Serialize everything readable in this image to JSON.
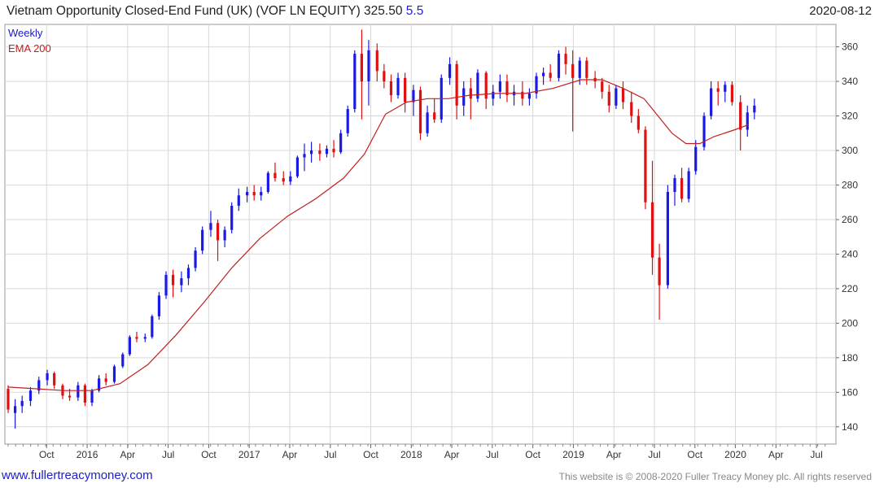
{
  "header": {
    "title": "Vietnam Opportunity Closed-End Fund (UK) (VOF LN EQUITY) 325.50",
    "change": "5.5",
    "date": "2020-08-12"
  },
  "footer": {
    "left": "www.fullertreacymoney.com",
    "right": "This website is © 2008-2020 Fuller Treacy Money plc. All rights reserved"
  },
  "chart_data": {
    "type": "candlestick",
    "legend": [
      {
        "label": "Weekly",
        "color": "#1a1ac8"
      },
      {
        "label": "EMA 200",
        "color": "#c02020"
      }
    ],
    "colors": {
      "up": "#1a1ae6",
      "down": "#e01010",
      "ema": "#c02020",
      "grid": "#d8d8d8"
    },
    "x_tick_labels": [
      "Oct",
      "2016",
      "Apr",
      "Jul",
      "Oct",
      "2017",
      "Apr",
      "Jul",
      "Oct",
      "2018",
      "Apr",
      "Jul",
      "Oct",
      "2019",
      "Apr",
      "Jul",
      "Oct",
      "2020",
      "Apr",
      "Jul"
    ],
    "y_ticks": [
      140,
      160,
      180,
      200,
      220,
      240,
      260,
      280,
      300,
      320,
      340,
      360
    ],
    "ylim": [
      130,
      373
    ],
    "x_range": [
      0,
      59
    ],
    "ohlc": [
      {
        "t": 0.0,
        "o": 162,
        "h": 164,
        "l": 148,
        "c": 150
      },
      {
        "t": 0.5,
        "o": 148,
        "h": 156,
        "l": 139,
        "c": 152
      },
      {
        "t": 1.0,
        "o": 152,
        "h": 158,
        "l": 148,
        "c": 155
      },
      {
        "t": 1.6,
        "o": 155,
        "h": 163,
        "l": 152,
        "c": 161
      },
      {
        "t": 2.2,
        "o": 161,
        "h": 169,
        "l": 159,
        "c": 167
      },
      {
        "t": 2.8,
        "o": 167,
        "h": 173,
        "l": 164,
        "c": 171
      },
      {
        "t": 3.3,
        "o": 171,
        "h": 172,
        "l": 162,
        "c": 164
      },
      {
        "t": 3.9,
        "o": 164,
        "h": 165,
        "l": 156,
        "c": 158
      },
      {
        "t": 4.4,
        "o": 158,
        "h": 162,
        "l": 155,
        "c": 157
      },
      {
        "t": 5.0,
        "o": 157,
        "h": 166,
        "l": 155,
        "c": 164
      },
      {
        "t": 5.5,
        "o": 164,
        "h": 165,
        "l": 152,
        "c": 154
      },
      {
        "t": 6.0,
        "o": 154,
        "h": 162,
        "l": 152,
        "c": 161
      },
      {
        "t": 6.5,
        "o": 161,
        "h": 170,
        "l": 160,
        "c": 168
      },
      {
        "t": 7.0,
        "o": 168,
        "h": 171,
        "l": 164,
        "c": 166
      },
      {
        "t": 7.6,
        "o": 166,
        "h": 176,
        "l": 165,
        "c": 175
      },
      {
        "t": 8.2,
        "o": 175,
        "h": 183,
        "l": 174,
        "c": 182
      },
      {
        "t": 8.7,
        "o": 182,
        "h": 193,
        "l": 181,
        "c": 192
      },
      {
        "t": 9.2,
        "o": 192,
        "h": 195,
        "l": 189,
        "c": 191
      },
      {
        "t": 9.8,
        "o": 191,
        "h": 194,
        "l": 189,
        "c": 192
      },
      {
        "t": 10.3,
        "o": 192,
        "h": 205,
        "l": 191,
        "c": 204
      },
      {
        "t": 10.8,
        "o": 204,
        "h": 218,
        "l": 202,
        "c": 216
      },
      {
        "t": 11.3,
        "o": 216,
        "h": 230,
        "l": 214,
        "c": 228
      },
      {
        "t": 11.8,
        "o": 228,
        "h": 231,
        "l": 215,
        "c": 222
      },
      {
        "t": 12.4,
        "o": 222,
        "h": 230,
        "l": 218,
        "c": 226
      },
      {
        "t": 12.9,
        "o": 226,
        "h": 234,
        "l": 222,
        "c": 232
      },
      {
        "t": 13.4,
        "o": 232,
        "h": 244,
        "l": 230,
        "c": 242
      },
      {
        "t": 13.9,
        "o": 242,
        "h": 256,
        "l": 240,
        "c": 254
      },
      {
        "t": 14.5,
        "o": 254,
        "h": 265,
        "l": 250,
        "c": 258
      },
      {
        "t": 15.0,
        "o": 258,
        "h": 260,
        "l": 236,
        "c": 248
      },
      {
        "t": 15.5,
        "o": 248,
        "h": 256,
        "l": 244,
        "c": 254
      },
      {
        "t": 16.0,
        "o": 254,
        "h": 270,
        "l": 252,
        "c": 268
      },
      {
        "t": 16.5,
        "o": 268,
        "h": 278,
        "l": 265,
        "c": 274
      },
      {
        "t": 17.1,
        "o": 274,
        "h": 279,
        "l": 270,
        "c": 276
      },
      {
        "t": 17.6,
        "o": 276,
        "h": 280,
        "l": 271,
        "c": 274
      },
      {
        "t": 18.1,
        "o": 274,
        "h": 279,
        "l": 271,
        "c": 276
      },
      {
        "t": 18.6,
        "o": 276,
        "h": 288,
        "l": 275,
        "c": 287
      },
      {
        "t": 19.1,
        "o": 287,
        "h": 293,
        "l": 282,
        "c": 284
      },
      {
        "t": 19.7,
        "o": 284,
        "h": 288,
        "l": 280,
        "c": 282
      },
      {
        "t": 20.2,
        "o": 282,
        "h": 288,
        "l": 280,
        "c": 285
      },
      {
        "t": 20.7,
        "o": 285,
        "h": 297,
        "l": 284,
        "c": 296
      },
      {
        "t": 21.2,
        "o": 296,
        "h": 304,
        "l": 288,
        "c": 298
      },
      {
        "t": 21.7,
        "o": 298,
        "h": 305,
        "l": 293,
        "c": 300
      },
      {
        "t": 22.3,
        "o": 300,
        "h": 304,
        "l": 294,
        "c": 298
      },
      {
        "t": 22.8,
        "o": 298,
        "h": 303,
        "l": 296,
        "c": 301
      },
      {
        "t": 23.3,
        "o": 301,
        "h": 306,
        "l": 296,
        "c": 299
      },
      {
        "t": 23.8,
        "o": 299,
        "h": 312,
        "l": 298,
        "c": 310
      },
      {
        "t": 24.3,
        "o": 310,
        "h": 326,
        "l": 308,
        "c": 324
      },
      {
        "t": 24.8,
        "o": 324,
        "h": 358,
        "l": 322,
        "c": 356
      },
      {
        "t": 25.3,
        "o": 356,
        "h": 370,
        "l": 318,
        "c": 340
      },
      {
        "t": 25.8,
        "o": 340,
        "h": 364,
        "l": 326,
        "c": 358
      },
      {
        "t": 26.4,
        "o": 358,
        "h": 362,
        "l": 340,
        "c": 346
      },
      {
        "t": 26.9,
        "o": 346,
        "h": 350,
        "l": 336,
        "c": 340
      },
      {
        "t": 27.4,
        "o": 340,
        "h": 344,
        "l": 328,
        "c": 332
      },
      {
        "t": 27.9,
        "o": 332,
        "h": 345,
        "l": 330,
        "c": 342
      },
      {
        "t": 28.4,
        "o": 342,
        "h": 345,
        "l": 322,
        "c": 328
      },
      {
        "t": 29.0,
        "o": 328,
        "h": 338,
        "l": 320,
        "c": 335
      },
      {
        "t": 29.5,
        "o": 335,
        "h": 337,
        "l": 306,
        "c": 310
      },
      {
        "t": 30.0,
        "o": 310,
        "h": 326,
        "l": 308,
        "c": 322
      },
      {
        "t": 30.5,
        "o": 322,
        "h": 330,
        "l": 316,
        "c": 318
      },
      {
        "t": 31.0,
        "o": 318,
        "h": 344,
        "l": 316,
        "c": 342
      },
      {
        "t": 31.6,
        "o": 342,
        "h": 354,
        "l": 338,
        "c": 350
      },
      {
        "t": 32.1,
        "o": 350,
        "h": 352,
        "l": 318,
        "c": 326
      },
      {
        "t": 32.6,
        "o": 326,
        "h": 340,
        "l": 320,
        "c": 336
      },
      {
        "t": 33.1,
        "o": 336,
        "h": 342,
        "l": 318,
        "c": 330
      },
      {
        "t": 33.6,
        "o": 330,
        "h": 347,
        "l": 328,
        "c": 345
      },
      {
        "t": 34.2,
        "o": 345,
        "h": 346,
        "l": 324,
        "c": 330
      },
      {
        "t": 34.7,
        "o": 330,
        "h": 338,
        "l": 326,
        "c": 334
      },
      {
        "t": 35.2,
        "o": 334,
        "h": 344,
        "l": 330,
        "c": 340
      },
      {
        "t": 35.7,
        "o": 340,
        "h": 344,
        "l": 328,
        "c": 332
      },
      {
        "t": 36.2,
        "o": 332,
        "h": 338,
        "l": 326,
        "c": 334
      },
      {
        "t": 36.8,
        "o": 334,
        "h": 340,
        "l": 326,
        "c": 330
      },
      {
        "t": 37.3,
        "o": 330,
        "h": 336,
        "l": 326,
        "c": 333
      },
      {
        "t": 37.8,
        "o": 333,
        "h": 345,
        "l": 330,
        "c": 343
      },
      {
        "t": 38.3,
        "o": 343,
        "h": 348,
        "l": 338,
        "c": 345
      },
      {
        "t": 38.8,
        "o": 345,
        "h": 350,
        "l": 340,
        "c": 342
      },
      {
        "t": 39.4,
        "o": 342,
        "h": 358,
        "l": 340,
        "c": 356
      },
      {
        "t": 39.9,
        "o": 356,
        "h": 360,
        "l": 344,
        "c": 350
      },
      {
        "t": 40.4,
        "o": 350,
        "h": 358,
        "l": 311,
        "c": 342
      },
      {
        "t": 40.9,
        "o": 342,
        "h": 354,
        "l": 338,
        "c": 352
      },
      {
        "t": 41.4,
        "o": 352,
        "h": 354,
        "l": 338,
        "c": 342
      },
      {
        "t": 42.0,
        "o": 342,
        "h": 346,
        "l": 336,
        "c": 340
      },
      {
        "t": 42.5,
        "o": 340,
        "h": 342,
        "l": 330,
        "c": 334
      },
      {
        "t": 43.0,
        "o": 334,
        "h": 338,
        "l": 322,
        "c": 326
      },
      {
        "t": 43.5,
        "o": 326,
        "h": 338,
        "l": 324,
        "c": 336
      },
      {
        "t": 44.0,
        "o": 336,
        "h": 340,
        "l": 324,
        "c": 328
      },
      {
        "t": 44.6,
        "o": 328,
        "h": 334,
        "l": 316,
        "c": 320
      },
      {
        "t": 45.1,
        "o": 320,
        "h": 324,
        "l": 310,
        "c": 312
      },
      {
        "t": 45.6,
        "o": 312,
        "h": 314,
        "l": 266,
        "c": 270
      },
      {
        "t": 46.1,
        "o": 270,
        "h": 294,
        "l": 228,
        "c": 238
      },
      {
        "t": 46.6,
        "o": 238,
        "h": 246,
        "l": 202,
        "c": 222
      },
      {
        "t": 47.2,
        "o": 222,
        "h": 280,
        "l": 220,
        "c": 276
      },
      {
        "t": 47.7,
        "o": 276,
        "h": 286,
        "l": 268,
        "c": 284
      },
      {
        "t": 48.2,
        "o": 284,
        "h": 290,
        "l": 270,
        "c": 272
      },
      {
        "t": 48.7,
        "o": 272,
        "h": 290,
        "l": 270,
        "c": 288
      },
      {
        "t": 49.2,
        "o": 288,
        "h": 306,
        "l": 286,
        "c": 302
      },
      {
        "t": 49.8,
        "o": 302,
        "h": 322,
        "l": 300,
        "c": 320
      },
      {
        "t": 50.3,
        "o": 320,
        "h": 340,
        "l": 318,
        "c": 336
      },
      {
        "t": 50.8,
        "o": 336,
        "h": 340,
        "l": 326,
        "c": 334
      },
      {
        "t": 51.3,
        "o": 334,
        "h": 340,
        "l": 328,
        "c": 338
      },
      {
        "t": 51.8,
        "o": 338,
        "h": 340,
        "l": 326,
        "c": 328
      },
      {
        "t": 52.4,
        "o": 328,
        "h": 332,
        "l": 300,
        "c": 312
      },
      {
        "t": 52.9,
        "o": 312,
        "h": 326,
        "l": 308,
        "c": 322
      },
      {
        "t": 53.4,
        "o": 322,
        "h": 330,
        "l": 318,
        "c": 326
      }
    ],
    "ema": [
      {
        "t": 0.0,
        "v": 163
      },
      {
        "t": 2.0,
        "v": 162
      },
      {
        "t": 4.0,
        "v": 161
      },
      {
        "t": 6.0,
        "v": 161
      },
      {
        "t": 8.0,
        "v": 165
      },
      {
        "t": 10.0,
        "v": 176
      },
      {
        "t": 12.0,
        "v": 193
      },
      {
        "t": 14.0,
        "v": 212
      },
      {
        "t": 16.0,
        "v": 232
      },
      {
        "t": 18.0,
        "v": 249
      },
      {
        "t": 20.0,
        "v": 262
      },
      {
        "t": 22.0,
        "v": 272
      },
      {
        "t": 24.0,
        "v": 284
      },
      {
        "t": 25.5,
        "v": 298
      },
      {
        "t": 27.0,
        "v": 321
      },
      {
        "t": 28.5,
        "v": 328
      },
      {
        "t": 30.0,
        "v": 330
      },
      {
        "t": 31.5,
        "v": 330
      },
      {
        "t": 33.0,
        "v": 332
      },
      {
        "t": 35.0,
        "v": 333
      },
      {
        "t": 37.0,
        "v": 333
      },
      {
        "t": 39.0,
        "v": 336
      },
      {
        "t": 41.0,
        "v": 341
      },
      {
        "t": 42.5,
        "v": 341
      },
      {
        "t": 44.0,
        "v": 336
      },
      {
        "t": 45.5,
        "v": 330
      },
      {
        "t": 46.5,
        "v": 320
      },
      {
        "t": 47.5,
        "v": 310
      },
      {
        "t": 48.5,
        "v": 304
      },
      {
        "t": 49.5,
        "v": 304
      },
      {
        "t": 50.5,
        "v": 308
      },
      {
        "t": 52.0,
        "v": 312
      },
      {
        "t": 53.0,
        "v": 315
      }
    ]
  }
}
